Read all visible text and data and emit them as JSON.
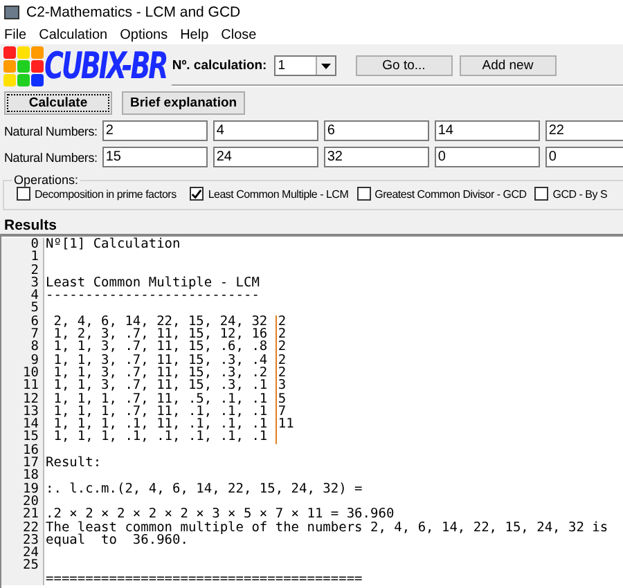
{
  "window": {
    "title": "C2-Mathematics - LCM and GCD"
  },
  "menu": [
    "File",
    "Calculation",
    "Options",
    "Help",
    "Close"
  ],
  "logo": {
    "text": "CUBIX-BR"
  },
  "toolbar": {
    "calc_label": "Nº. calculation:",
    "calc_value": "1",
    "buttons": [
      "Go to...",
      "Add new"
    ]
  },
  "actions": [
    {
      "label": "Calculate",
      "focused": true
    },
    {
      "label": "Brief explanation",
      "focused": false
    }
  ],
  "number_rows": [
    {
      "label": "Natural Numbers:",
      "values": [
        "2",
        "4",
        "6",
        "14",
        "22"
      ]
    },
    {
      "label": "Natural Numbers:",
      "values": [
        "15",
        "24",
        "32",
        "0",
        "0"
      ]
    }
  ],
  "operations": {
    "title": "Operations:",
    "options": [
      {
        "label": "Decomposition in prime factors",
        "checked": false
      },
      {
        "label": "Least Common Multiple - LCM",
        "checked": true
      },
      {
        "label": "Greatest Common Divisor - GCD",
        "checked": false
      },
      {
        "label": "GCD - By S",
        "checked": false
      }
    ]
  },
  "results": {
    "title": "Results",
    "lines": [
      {
        "num": "0",
        "kind": "text",
        "text": "Nº[1] Calculation"
      },
      {
        "num": "1",
        "kind": "text"
      },
      {
        "num": "2",
        "kind": "text"
      },
      {
        "num": "3",
        "kind": "text",
        "text": "Least Common Multiple - LCM"
      },
      {
        "num": "4",
        "kind": "text",
        "text": "---------------------------"
      },
      {
        "num": "5",
        "kind": "text"
      },
      {
        "num": "6",
        "kind": "factor",
        "text": " 2, 4, 6, 14, 22, 15, 24, 32 ",
        "divisor": "2"
      },
      {
        "num": "7",
        "kind": "factor",
        "text": " 1, 2, 3, .7, 11, 15, 12, 16 ",
        "divisor": "2"
      },
      {
        "num": "8",
        "kind": "factor",
        "text": " 1, 1, 3, .7, 11, 15, .6, .8 ",
        "divisor": "2"
      },
      {
        "num": "9",
        "kind": "factor",
        "text": " 1, 1, 3, .7, 11, 15, .3, .4 ",
        "divisor": "2"
      },
      {
        "num": "10",
        "kind": "factor",
        "text": " 1, 1, 3, .7, 11, 15, .3, .2 ",
        "divisor": "2"
      },
      {
        "num": "11",
        "kind": "factor",
        "text": " 1, 1, 3, .7, 11, 15, .3, .1 ",
        "divisor": "3"
      },
      {
        "num": "12",
        "kind": "factor",
        "text": " 1, 1, 1, .7, 11, .5, .1, .1 ",
        "divisor": "5"
      },
      {
        "num": "13",
        "kind": "factor",
        "text": " 1, 1, 1, .7, 11, .1, .1, .1 ",
        "divisor": "7"
      },
      {
        "num": "14",
        "kind": "factor",
        "text": " 1, 1, 1, .1, 11, .1, .1, .1 ",
        "divisor": "11"
      },
      {
        "num": "15",
        "kind": "factor",
        "text": " 1, 1, 1, .1, .1, .1, .1, .1 "
      },
      {
        "num": "16",
        "kind": "text"
      },
      {
        "num": "17",
        "kind": "text",
        "text": "Result:"
      },
      {
        "num": "18",
        "kind": "text"
      },
      {
        "num": "19",
        "kind": "text",
        "text": ":. l.c.m.(2, 4, 6, 14, 22, 15, 24, 32) ="
      },
      {
        "num": "20",
        "kind": "text"
      },
      {
        "num": "21",
        "kind": "text",
        "text": ".2 × 2 × 2 × 2 × 2 × 3 × 5 × 7 × 11 = 36.960"
      },
      {
        "num": "22",
        "kind": "text",
        "text": "The least common multiple of the numbers 2, 4, 6, 14, 22, 15, 24, 32 is"
      },
      {
        "num": "23",
        "kind": "text",
        "text": "equal  to  36.960."
      },
      {
        "num": "24",
        "kind": "text"
      },
      {
        "num": "25",
        "kind": "text"
      },
      {
        "kind": "text",
        "text": "========================================"
      }
    ]
  }
}
